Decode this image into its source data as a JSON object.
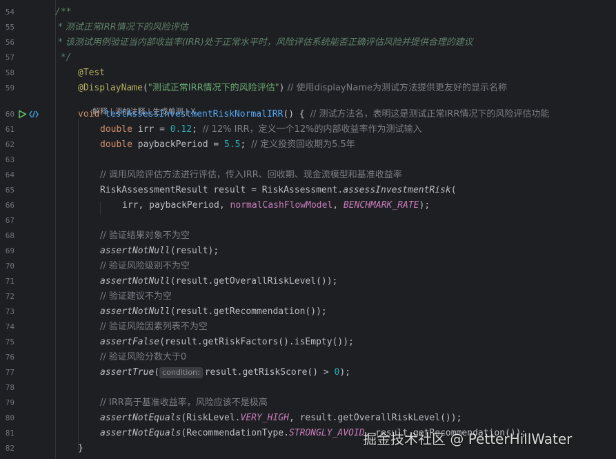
{
  "gutter": {
    "line_numbers": [
      "54",
      "55",
      "56",
      "57",
      "58",
      "59",
      "60",
      "61",
      "62",
      "63",
      "64",
      "65",
      "66",
      "67",
      "68",
      "69",
      "70",
      "71",
      "72",
      "73",
      "74",
      "75",
      "76",
      "77",
      "78",
      "79",
      "80",
      "81",
      "82"
    ]
  },
  "icons": {
    "run": "run-test-icon",
    "test": "test-method-icon"
  },
  "doc": {
    "open": "/**",
    "line1": " * 测试正常IRR情况下的风险评估",
    "line2": " * 该测试用例验证当内部收益率(IRR)处于正常水平时，风险评估系统能否正确评估风险并提供合理的建议",
    "close": " */"
  },
  "annotations": {
    "test": "@Test",
    "display_name": "@DisplayName",
    "display_name_open": "(",
    "display_name_value": "\"测试正常IRR情况下的风险评估\"",
    "display_name_close": ")",
    "display_name_comment": " // 使用displayName为测试方法提供更友好的显示名称"
  },
  "code_lens": {
    "explain": "解释",
    "sep1": " | ",
    "add_comment": "添加注释",
    "sep2": " | ",
    "gen_test": "生成单测",
    "sep3": " | ",
    "close": "X"
  },
  "method": {
    "kw_void": "void",
    "name": "testAssessInvestmentRiskNormalIRR",
    "sig_rest": "() { ",
    "comment": "// 测试方法名，表明这是测试正常IRR情况下的风险评估功能"
  },
  "vars": {
    "irr_type": "double",
    "irr_decl": " irr = ",
    "irr_val": "0.12",
    "irr_semi": "; ",
    "irr_comment": "// 12% IRR，定义一个12%的内部收益率作为测试输入",
    "pb_type": "double",
    "pb_decl": " paybackPeriod = ",
    "pb_val": "5.5",
    "pb_semi": "; ",
    "pb_comment": "// 定义投资回收期为5.5年"
  },
  "call": {
    "comment": "// 调用风险评估方法进行评估，传入IRR、回收期、现金流模型和基准收益率",
    "decl": "RiskAssessmentResult result = RiskAssessment.",
    "method": "assessInvestmentRisk",
    "open": "(",
    "args_plain": "irr, paybackPeriod, ",
    "arg_field": "normalCashFlowModel",
    "comma": ", ",
    "arg_const": "BENCHMARK_RATE",
    "end": ");"
  },
  "asserts": [
    {
      "comment": "// 验证结果对象不为空",
      "fn": "assertNotNull",
      "rest": "(result);"
    },
    {
      "comment": "// 验证风险级别不为空",
      "fn": "assertNotNull",
      "rest": "(result.getOverallRiskLevel());"
    },
    {
      "comment": "// 验证建议不为空",
      "fn": "assertNotNull",
      "rest": "(result.getRecommendation());"
    },
    {
      "comment": "// 验证风险因素列表不为空",
      "fn": "assertFalse",
      "rest": "(result.getRiskFactors().isEmpty());"
    }
  ],
  "assert_true": {
    "comment": "// 验证风险分数大于0",
    "fn": "assertTrue",
    "open": "(",
    "hint": "condition:",
    "rest": "result.getRiskScore() > ",
    "num": "0",
    "end": ");"
  },
  "irr_check": {
    "comment": "// IRR高于基准收益率，风险应该不是极高",
    "fn1": "assertNotEquals",
    "a1": "(RiskLevel.",
    "c1": "VERY_HIGH",
    "b1": ", result.getOverallRiskLevel());",
    "fn2": "assertNotEquals",
    "a2": "(RecommendationType.",
    "c2": "STRONGLY_AVOID",
    "b2": ", result.getRecommendation());"
  },
  "closing_brace": "}",
  "watermark": "掘金技术社区 @ PetterHillWater"
}
